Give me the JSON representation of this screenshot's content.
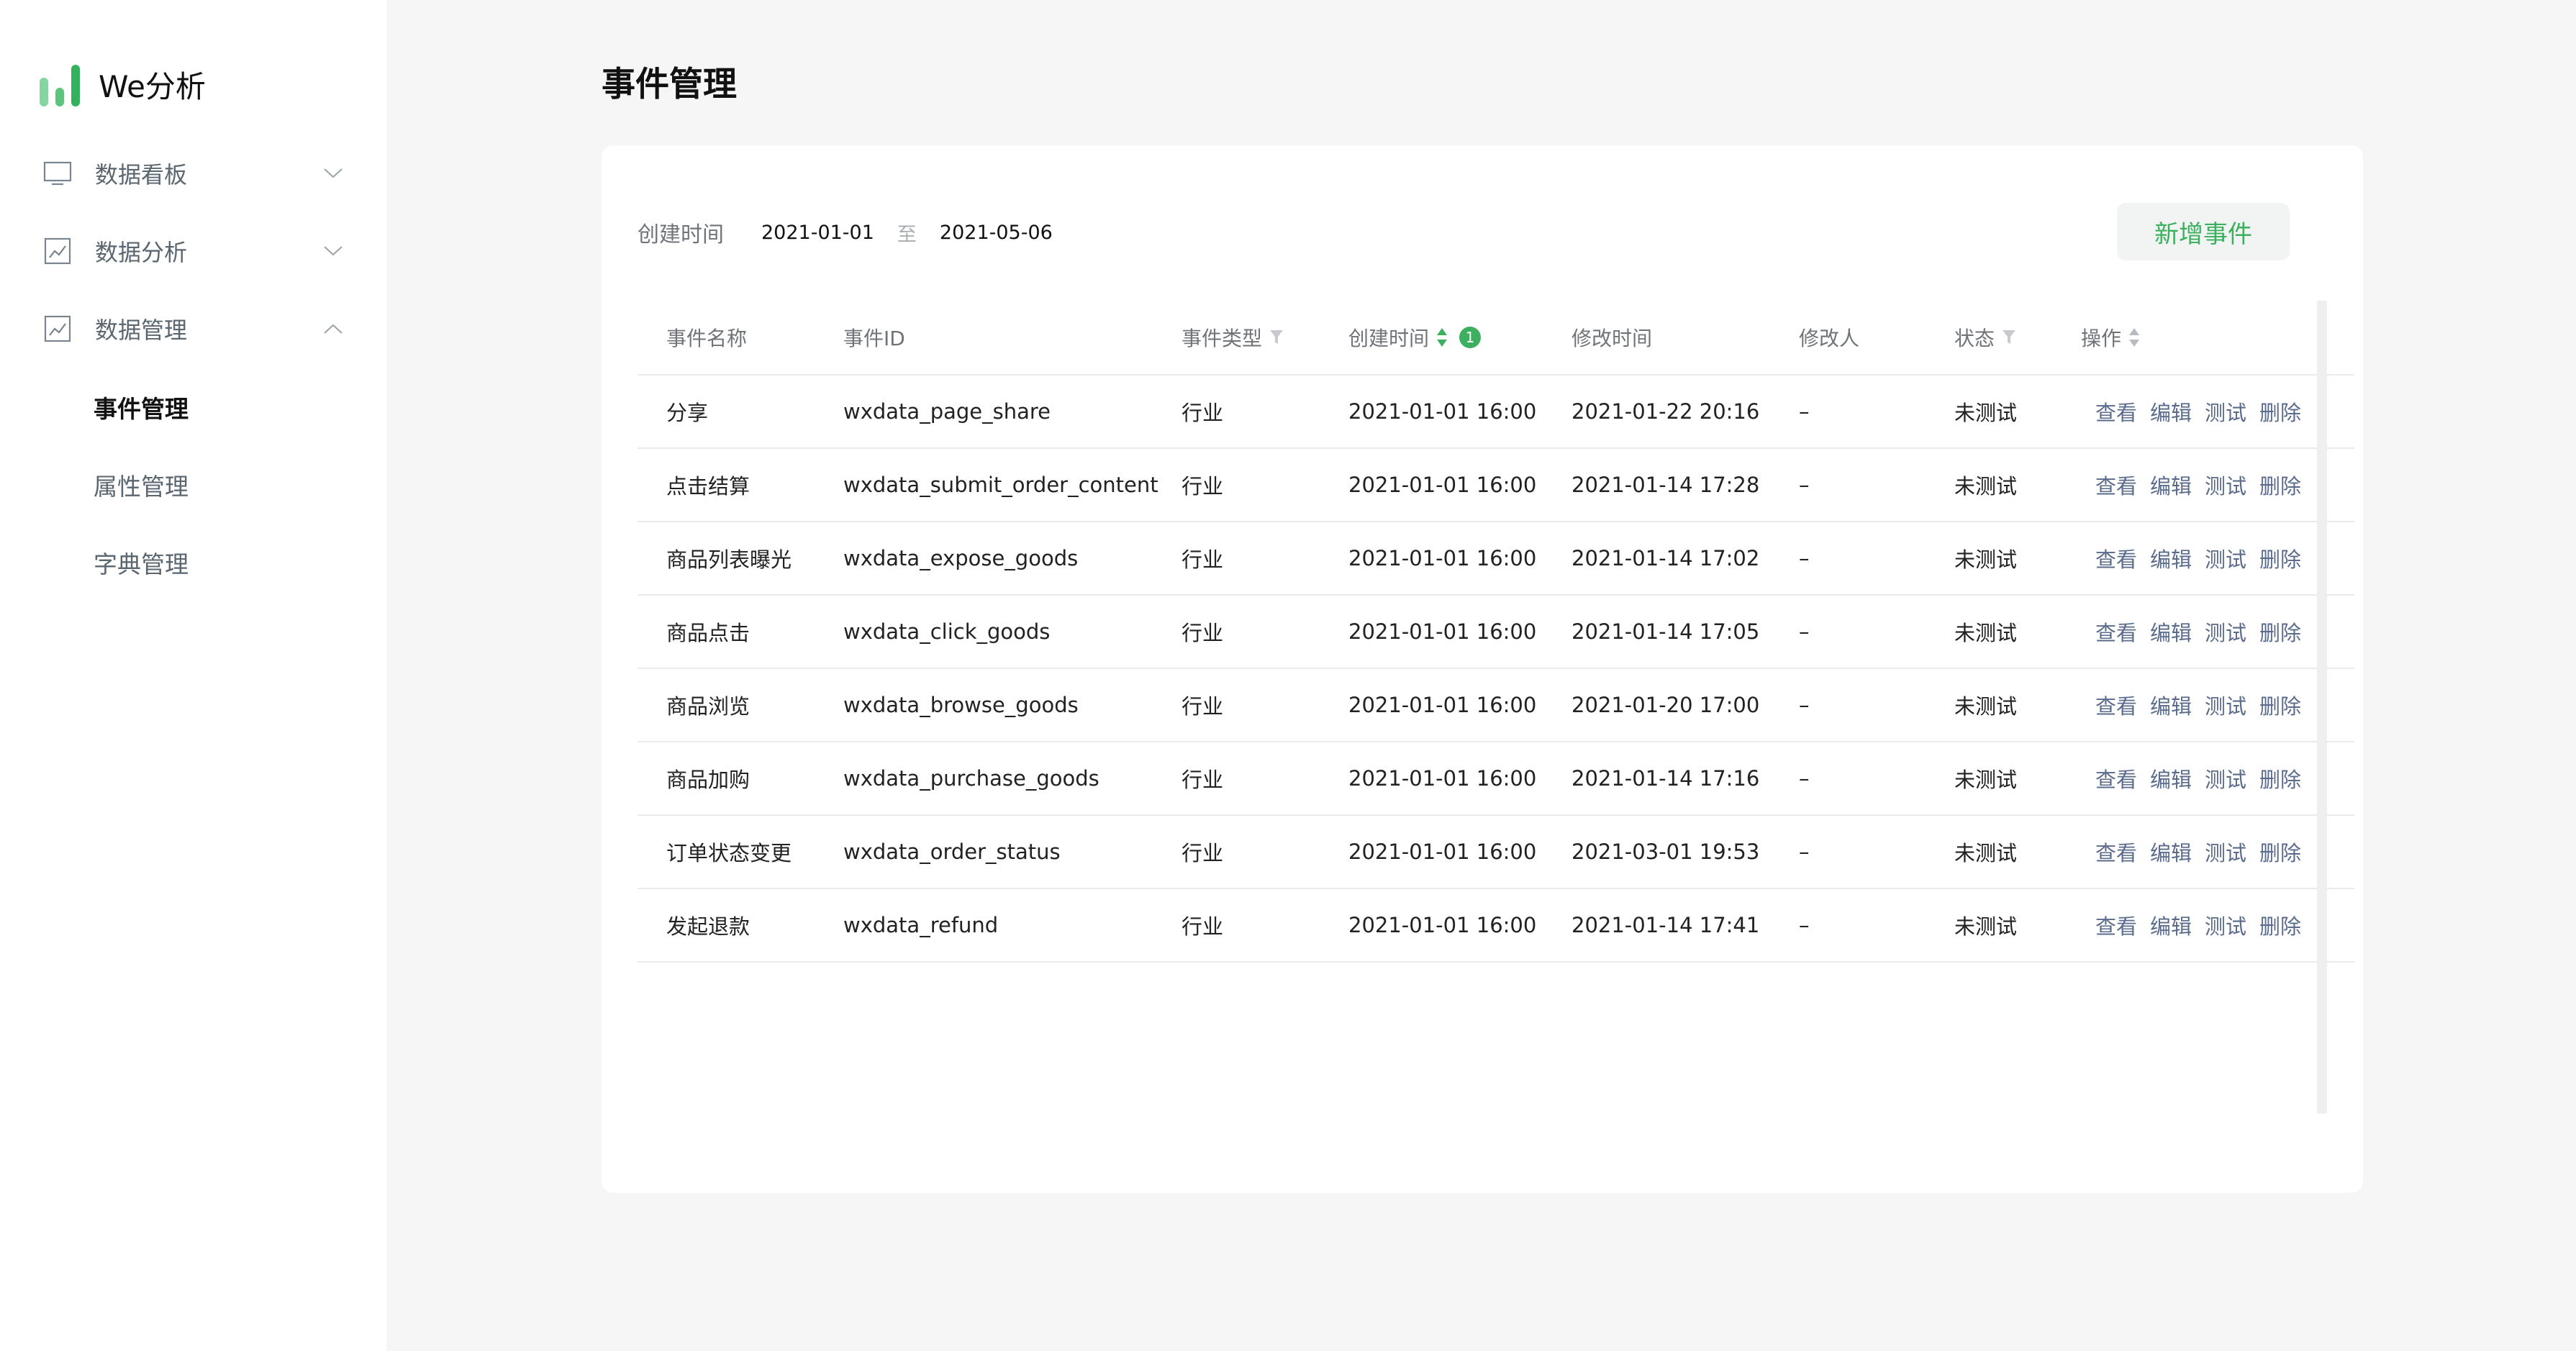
{
  "brand": {
    "name": "We分析"
  },
  "sidebar": {
    "items": [
      {
        "label": "数据看板",
        "icon": "monitor-icon",
        "expanded": false
      },
      {
        "label": "数据分析",
        "icon": "chart-icon",
        "expanded": false
      },
      {
        "label": "数据管理",
        "icon": "chart-icon",
        "expanded": true
      }
    ],
    "sub_items": [
      {
        "label": "事件管理",
        "active": true
      },
      {
        "label": "属性管理",
        "active": false
      },
      {
        "label": "字典管理",
        "active": false
      }
    ]
  },
  "page": {
    "title": "事件管理"
  },
  "filter": {
    "label": "创建时间",
    "start_date": "2021-01-01",
    "separator": "至",
    "end_date": "2021-05-06"
  },
  "actions": {
    "add_event_label": "新增事件"
  },
  "table": {
    "headers": {
      "name": "事件名称",
      "id": "事件ID",
      "type": "事件类型",
      "created": "创建时间",
      "created_sort_badge": "1",
      "modified": "修改时间",
      "modifier": "修改人",
      "status": "状态",
      "ops": "操作"
    },
    "op_labels": {
      "view": "查看",
      "edit": "编辑",
      "test": "测试",
      "delete": "删除"
    },
    "rows": [
      {
        "name": "分享",
        "id": "wxdata_page_share",
        "type": "行业",
        "created": "2021-01-01 16:00",
        "modified": "2021-01-22 20:16",
        "modifier": "–",
        "status": "未测试"
      },
      {
        "name": "点击结算",
        "id": "wxdata_submit_order_content",
        "type": "行业",
        "created": "2021-01-01 16:00",
        "modified": "2021-01-14 17:28",
        "modifier": "–",
        "status": "未测试"
      },
      {
        "name": "商品列表曝光",
        "id": "wxdata_expose_goods",
        "type": "行业",
        "created": "2021-01-01 16:00",
        "modified": "2021-01-14 17:02",
        "modifier": "–",
        "status": "未测试"
      },
      {
        "name": "商品点击",
        "id": "wxdata_click_goods",
        "type": "行业",
        "created": "2021-01-01 16:00",
        "modified": "2021-01-14 17:05",
        "modifier": "–",
        "status": "未测试"
      },
      {
        "name": "商品浏览",
        "id": "wxdata_browse_goods",
        "type": "行业",
        "created": "2021-01-01 16:00",
        "modified": "2021-01-20 17:00",
        "modifier": "–",
        "status": "未测试"
      },
      {
        "name": "商品加购",
        "id": "wxdata_purchase_goods",
        "type": "行业",
        "created": "2021-01-01 16:00",
        "modified": "2021-01-14 17:16",
        "modifier": "–",
        "status": "未测试"
      },
      {
        "name": "订单状态变更",
        "id": "wxdata_order_status",
        "type": "行业",
        "created": "2021-01-01 16:00",
        "modified": "2021-03-01 19:53",
        "modifier": "–",
        "status": "未测试"
      },
      {
        "name": "发起退款",
        "id": "wxdata_refund",
        "type": "行业",
        "created": "2021-01-01 16:00",
        "modified": "2021-01-14 17:41",
        "modifier": "–",
        "status": "未测试"
      }
    ]
  },
  "colors": {
    "accent": "#3cb05e",
    "link": "#5a6b8c",
    "sidebar_bg": "#ffffff",
    "page_bg": "#f6f6f6"
  }
}
